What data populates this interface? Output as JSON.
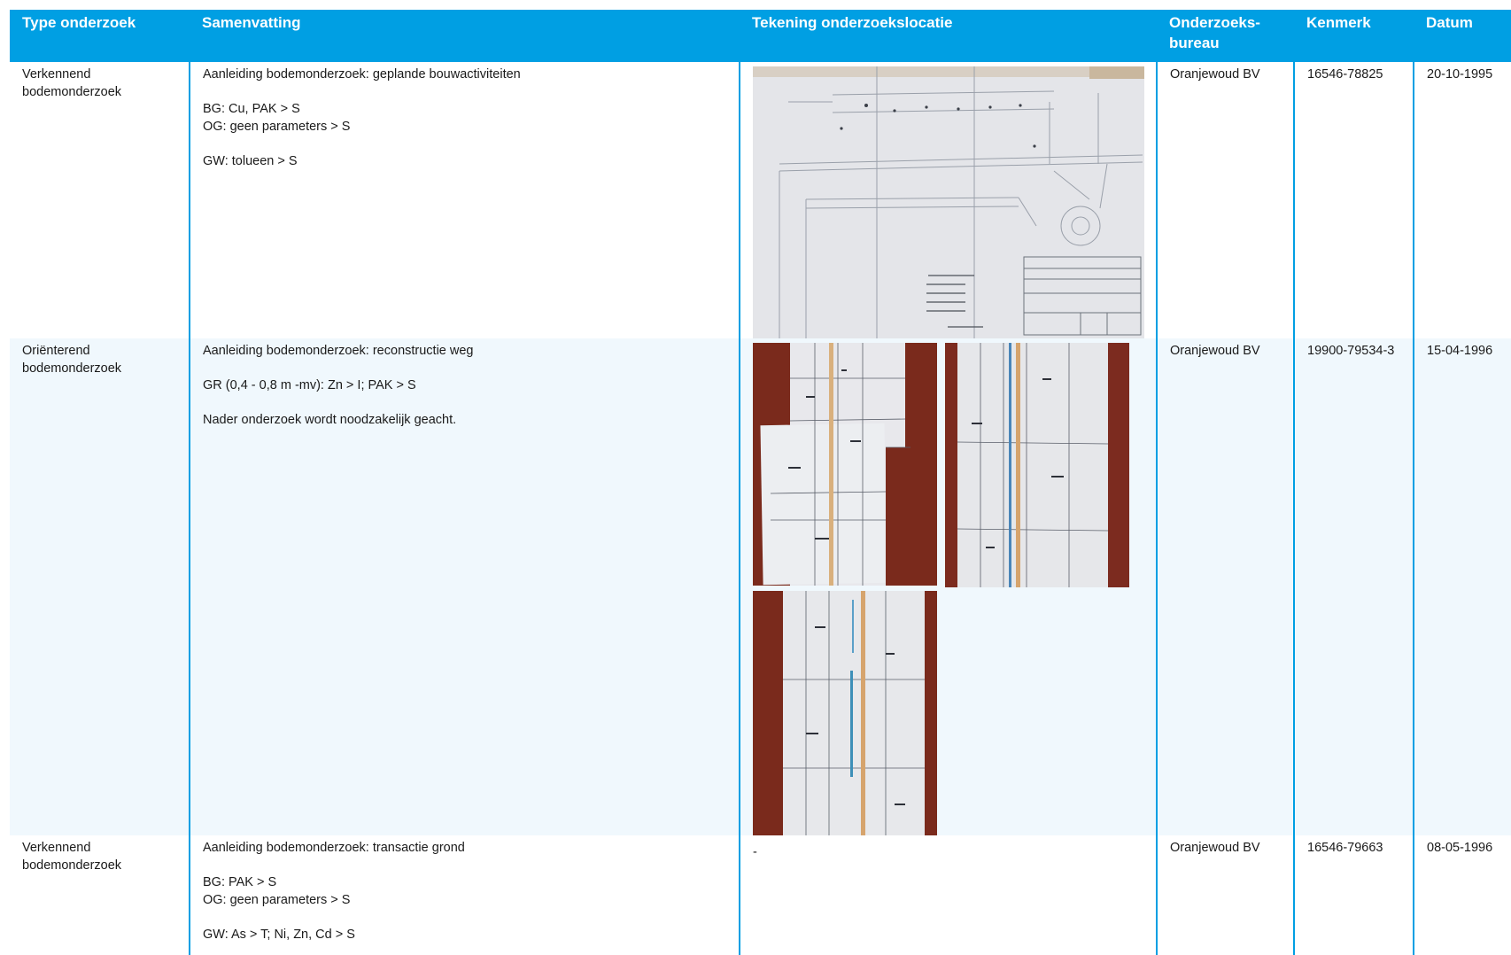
{
  "columns": [
    "Type onderzoek",
    "Samenvatting",
    "Tekening onderzoekslocatie",
    "Onderzoeks-\nbureau",
    "Kenmerk",
    "Datum"
  ],
  "rows": [
    {
      "type": "Verkennend bodemonderzoek",
      "summary": [
        "Aanleiding bodemonderzoek: geplande bouwactiviteiten",
        "",
        "BG: Cu, PAK > S",
        "OG: geen parameters > S",
        "",
        "GW: tolueen > S"
      ],
      "drawing": "image",
      "bureau": "Oranjewoud BV",
      "kenmerk": "16546-78825",
      "datum": "20-10-1995"
    },
    {
      "type": "Oriënterend bodemonderzoek",
      "summary": [
        "Aanleiding bodemonderzoek: reconstructie weg",
        "",
        "GR (0,4 - 0,8 m -mv): Zn > I; PAK > S",
        "",
        "Nader onderzoek wordt noodzakelijk geacht."
      ],
      "drawing": "images",
      "bureau": "Oranjewoud BV",
      "kenmerk": "19900-79534-3",
      "datum": "15-04-1996"
    },
    {
      "type": "Verkennend bodemonderzoek",
      "summary": [
        "Aanleiding bodemonderzoek: transactie grond",
        "",
        "BG: PAK > S",
        "OG: geen parameters > S",
        "",
        "GW: As > T; Ni, Zn, Cd > S"
      ],
      "drawing": "-",
      "bureau": "Oranjewoud BV",
      "kenmerk": "16546-79663",
      "datum": "08-05-1996"
    }
  ],
  "colors": {
    "header_bg": "#009fe3",
    "header_text": "#ffffff",
    "row_alt_bg": "#f0f8fd",
    "paper": "#e6e7ea",
    "carpet": "#7a2a1c"
  }
}
